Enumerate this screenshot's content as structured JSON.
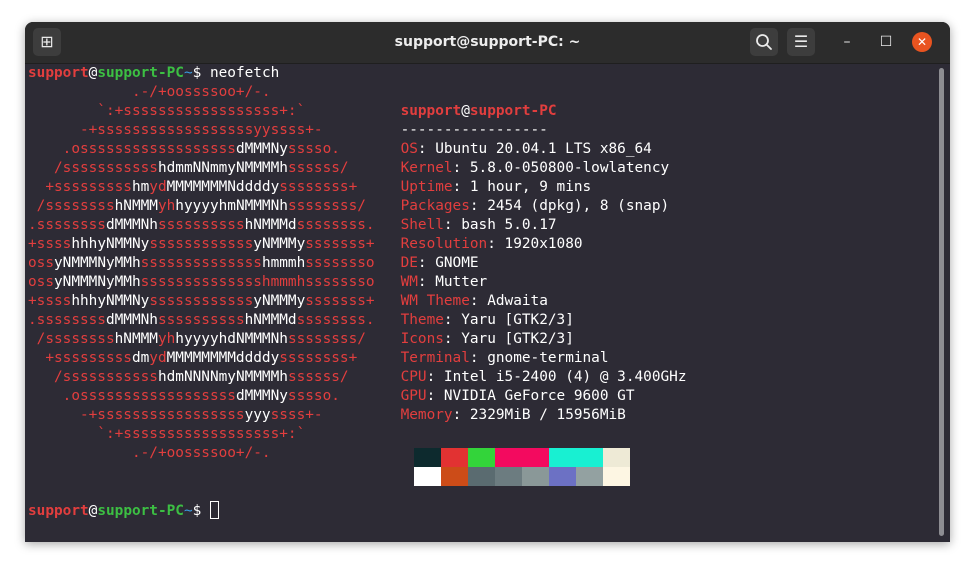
{
  "window": {
    "title": "support@support-PC: ~"
  },
  "titlebar": {
    "new_tab_icon": "new-tab-icon",
    "search_icon": "search-icon",
    "menu_icon": "hamburger-menu-icon",
    "minimize_icon": "minimize-icon",
    "maximize_icon": "maximize-icon",
    "close_icon": "close-icon",
    "new_tab_glyph": "⊞",
    "menu_glyph": "☰",
    "min_glyph": "–",
    "max_glyph": "☐",
    "close_glyph": "✕"
  },
  "prompt": {
    "user": "support",
    "at": "@",
    "host": "support-PC",
    "path": "~",
    "symbol": "$",
    "command": " neofetch"
  },
  "ascii_art": [
    [
      [
        "r",
        "            .-/+oossssoo+/-."
      ]
    ],
    [
      [
        "r",
        "        `:+ssssssssssssssssss+:`"
      ]
    ],
    [
      [
        "r",
        "      -+ssssssssssssssssssyyssss+-"
      ]
    ],
    [
      [
        "r",
        "    .ossssssssssssssssss"
      ],
      [
        "w",
        "dMMMNy"
      ],
      [
        "r",
        "sssso."
      ]
    ],
    [
      [
        "r",
        "   /sssssssssss"
      ],
      [
        "w",
        "hdmmNNmmyNMMMMh"
      ],
      [
        "r",
        "ssssss/"
      ]
    ],
    [
      [
        "r",
        "  +sssssssss"
      ],
      [
        "w",
        "hm"
      ],
      [
        "r",
        "yd"
      ],
      [
        "w",
        "MMMMMMMNddddy"
      ],
      [
        "r",
        "ssssssss+"
      ]
    ],
    [
      [
        "r",
        " /ssssssss"
      ],
      [
        "w",
        "hNMMM"
      ],
      [
        "r",
        "yh"
      ],
      [
        "w",
        "hyyyyhmNMMMNh"
      ],
      [
        "r",
        "ssssssss/"
      ]
    ],
    [
      [
        "r",
        ".ssssssss"
      ],
      [
        "w",
        "dMMMNh"
      ],
      [
        "r",
        "ssssssssss"
      ],
      [
        "w",
        "hNMMMd"
      ],
      [
        "r",
        "ssssssss."
      ]
    ],
    [
      [
        "r",
        "+ssss"
      ],
      [
        "w",
        "hhhyNMMNy"
      ],
      [
        "r",
        "ssssssssssss"
      ],
      [
        "w",
        "yNMMMy"
      ],
      [
        "r",
        "sssssss+"
      ]
    ],
    [
      [
        "r",
        "oss"
      ],
      [
        "w",
        "yNMMMNyMMh"
      ],
      [
        "r",
        "ssssssssssssss"
      ],
      [
        "w",
        "hmmmh"
      ],
      [
        "r",
        "ssssssso"
      ]
    ],
    [
      [
        "r",
        "oss"
      ],
      [
        "w",
        "yNMMMNyMMh"
      ],
      [
        "r",
        "sssssssssssssshmmmhssssssso"
      ]
    ],
    [
      [
        "r",
        "+ssss"
      ],
      [
        "w",
        "hhhyNMMNy"
      ],
      [
        "r",
        "ssssssssssss"
      ],
      [
        "w",
        "yNMMMy"
      ],
      [
        "r",
        "sssssss+"
      ]
    ],
    [
      [
        "r",
        ".ssssssss"
      ],
      [
        "w",
        "dMMMNh"
      ],
      [
        "r",
        "ssssssssss"
      ],
      [
        "w",
        "hNMMMd"
      ],
      [
        "r",
        "ssssssss."
      ]
    ],
    [
      [
        "r",
        " /ssssssss"
      ],
      [
        "w",
        "hNMMM"
      ],
      [
        "r",
        "yh"
      ],
      [
        "w",
        "hyyyyhdNMMMNh"
      ],
      [
        "r",
        "ssssssss/"
      ]
    ],
    [
      [
        "r",
        "  +sssssssss"
      ],
      [
        "w",
        "dm"
      ],
      [
        "r",
        "yd"
      ],
      [
        "w",
        "MMMMMMMMddddy"
      ],
      [
        "r",
        "ssssssss+"
      ]
    ],
    [
      [
        "r",
        "   /sssssssssss"
      ],
      [
        "w",
        "hdmNNNNmyNMMMMh"
      ],
      [
        "r",
        "ssssss/"
      ]
    ],
    [
      [
        "r",
        "    .ossssssssssssssssss"
      ],
      [
        "w",
        "dMMMNy"
      ],
      [
        "r",
        "sssso."
      ]
    ],
    [
      [
        "r",
        "      -+sssssssssssssssss"
      ],
      [
        "w",
        "yyy"
      ],
      [
        "r",
        "ssss+-"
      ]
    ],
    [
      [
        "r",
        "        `:+ssssssssssssssssss+:`"
      ]
    ],
    [
      [
        "r",
        "            .-/+oossssoo+/-."
      ]
    ]
  ],
  "info": {
    "user": "support",
    "at": "@",
    "host": "support-PC",
    "separator": "-----------------",
    "fields": [
      {
        "key": "OS",
        "value": "Ubuntu 20.04.1 LTS x86_64"
      },
      {
        "key": "Kernel",
        "value": "5.8.0-050800-lowlatency"
      },
      {
        "key": "Uptime",
        "value": "1 hour, 9 mins"
      },
      {
        "key": "Packages",
        "value": "2454 (dpkg), 8 (snap)"
      },
      {
        "key": "Shell",
        "value": "bash 5.0.17"
      },
      {
        "key": "Resolution",
        "value": "1920x1080"
      },
      {
        "key": "DE",
        "value": "GNOME"
      },
      {
        "key": "WM",
        "value": "Mutter"
      },
      {
        "key": "WM Theme",
        "value": "Adwaita"
      },
      {
        "key": "Theme",
        "value": "Yaru [GTK2/3]"
      },
      {
        "key": "Icons",
        "value": "Yaru [GTK2/3]"
      },
      {
        "key": "Terminal",
        "value": "gnome-terminal"
      },
      {
        "key": "CPU",
        "value": "Intel i5-2400 (4) @ 3.400GHz"
      },
      {
        "key": "GPU",
        "value": "NVIDIA GeForce 9600 GT"
      },
      {
        "key": "Memory",
        "value": "2329MiB / 15956MiB"
      }
    ]
  },
  "palette": {
    "row1": [
      "#0d2a2e",
      "#e23232",
      "#33d43a",
      "#f30a5f",
      "#f30a5f",
      "#18f0d2",
      "#18f0d2",
      "#eeead6"
    ],
    "row2": [
      "#ffffff",
      "#cc4c18",
      "#5a6b70",
      "#6c7c80",
      "#8a9898",
      "#6c71c4",
      "#93a1a1",
      "#fdf6e3"
    ]
  }
}
